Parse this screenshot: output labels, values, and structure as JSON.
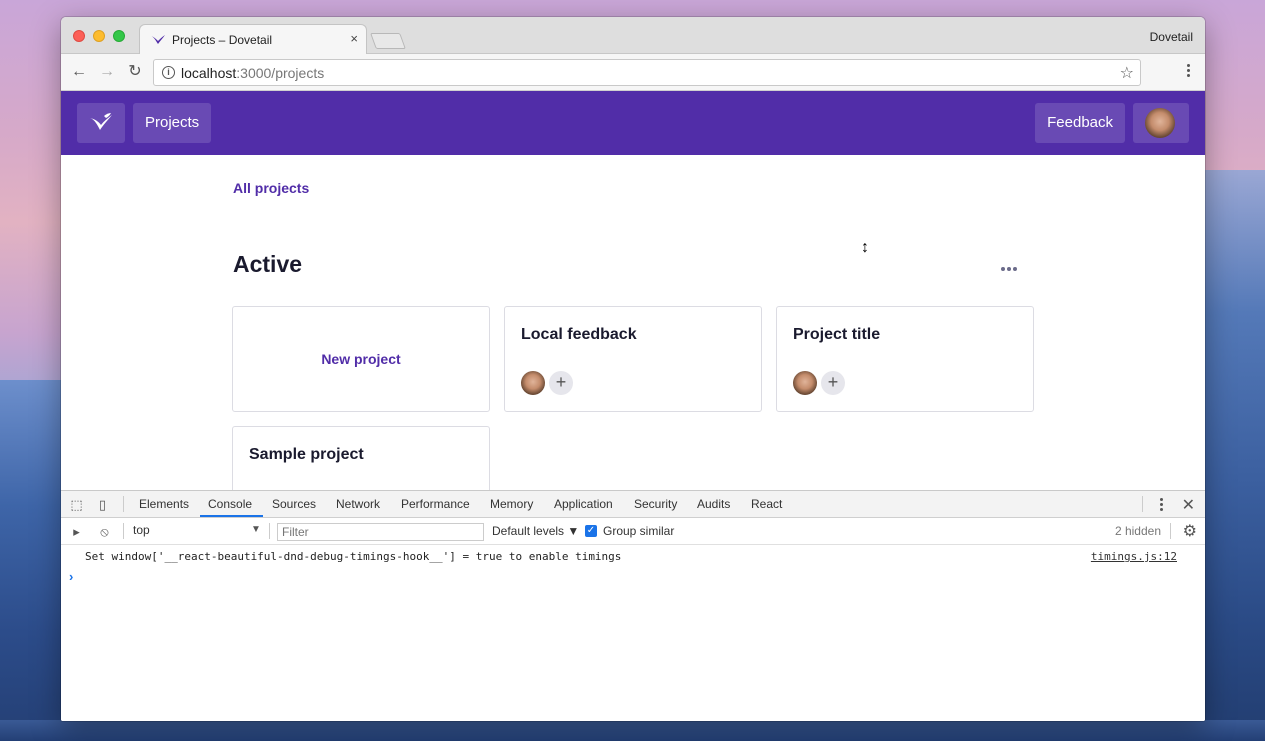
{
  "browser": {
    "tab_title": "Projects – Dovetail",
    "tab_close": "×",
    "profile_name": "Dovetail",
    "url_host": "localhost",
    "url_path": ":3000/projects",
    "back_icon": "←",
    "forward_icon": "→",
    "reload_icon": "↻",
    "star_icon": "☆"
  },
  "app_header": {
    "projects_label": "Projects",
    "feedback_label": "Feedback",
    "brand_color": "#512da8"
  },
  "page": {
    "breadcrumb": "All projects",
    "section_title": "Active",
    "cursor_glyph": "↕",
    "new_project_label": "New project",
    "projects": [
      {
        "title": "Local feedback"
      },
      {
        "title": "Project title"
      },
      {
        "title": "Sample project"
      }
    ],
    "add_member_glyph": "+"
  },
  "devtools": {
    "tabs": [
      "Elements",
      "Console",
      "Sources",
      "Network",
      "Performance",
      "Memory",
      "Application",
      "Security",
      "Audits",
      "React"
    ],
    "active_tab": "Console",
    "context": "top",
    "context_arrow": "▼",
    "filter_placeholder": "Filter",
    "levels": "Default levels ▼",
    "group_similar": "Group similar",
    "group_similar_checked": true,
    "checkmark": "✓",
    "hidden_count": "2 hidden",
    "close_icon": "✕",
    "gear_icon": "⚙",
    "clear_icon": "⦸",
    "console_message": "Set window['__react-beautiful-dnd-debug-timings-hook__'] = true to enable timings",
    "console_source": "timings.js:12",
    "prompt": "›"
  }
}
